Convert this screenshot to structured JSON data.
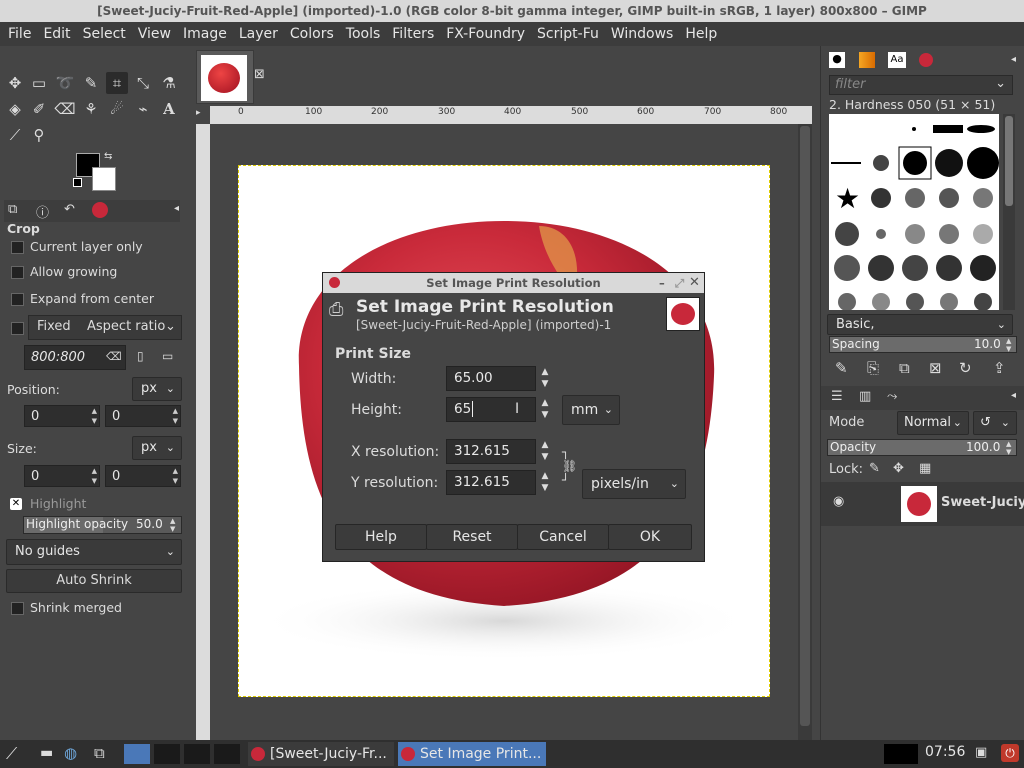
{
  "window": {
    "title": "[Sweet-Juciy-Fruit-Red-Apple] (imported)-1.0 (RGB color 8-bit gamma integer, GIMP built-in sRGB, 1 layer) 800x800 – GIMP"
  },
  "menu": [
    "File",
    "Edit",
    "Select",
    "View",
    "Image",
    "Layer",
    "Colors",
    "Tools",
    "Filters",
    "FX-Foundry",
    "Script-Fu",
    "Windows",
    "Help"
  ],
  "tool_options": {
    "title": "Crop",
    "current_layer_only": "Current layer only",
    "allow_growing": "Allow growing",
    "expand_from_center": "Expand from center",
    "fixed": "Fixed",
    "aspect_mode": "Aspect ratio",
    "ratio_value": "800:800",
    "position_label": "Position:",
    "position_unit": "px",
    "pos_x": "0",
    "pos_y": "0",
    "size_label": "Size:",
    "size_unit": "px",
    "size_x": "0",
    "size_y": "0",
    "highlight": "Highlight",
    "highlight_opacity_label": "Highlight opacity",
    "highlight_opacity_value": "50.0",
    "guides": "No guides",
    "auto_shrink": "Auto Shrink",
    "shrink_merged": "Shrink merged"
  },
  "ruler": {
    "h_ticks": [
      "0",
      "100",
      "200",
      "300",
      "400",
      "500",
      "600",
      "700",
      "800"
    ]
  },
  "brushes": {
    "filter_placeholder": "filter",
    "selected_brush": "2. Hardness 050 (51 × 51)",
    "preset": "Basic,",
    "spacing_label": "Spacing",
    "spacing_value": "10.0"
  },
  "layers": {
    "mode_label": "Mode",
    "mode_value": "Normal",
    "opacity_label": "Opacity",
    "opacity_value": "100.0",
    "lock_label": "Lock:",
    "layer_name": "Sweet-Juciy"
  },
  "dialog": {
    "window_title": "Set Image Print Resolution",
    "heading": "Set Image Print Resolution",
    "subheading": "[Sweet-Juciy-Fruit-Red-Apple] (imported)-1",
    "section": "Print Size",
    "width_label": "Width:",
    "width_value": "65.00",
    "height_label": "Height:",
    "height_value": "65",
    "size_unit": "mm",
    "xres_label": "X resolution:",
    "xres_value": "312.615",
    "yres_label": "Y resolution:",
    "yres_value": "312.615",
    "res_unit": "pixels/in",
    "buttons": {
      "help": "Help",
      "reset": "Reset",
      "cancel": "Cancel",
      "ok": "OK"
    }
  },
  "taskbar": {
    "task1": "[Sweet-Juciy-Fr...",
    "task2": "Set Image Print...",
    "clock": "07:56"
  }
}
